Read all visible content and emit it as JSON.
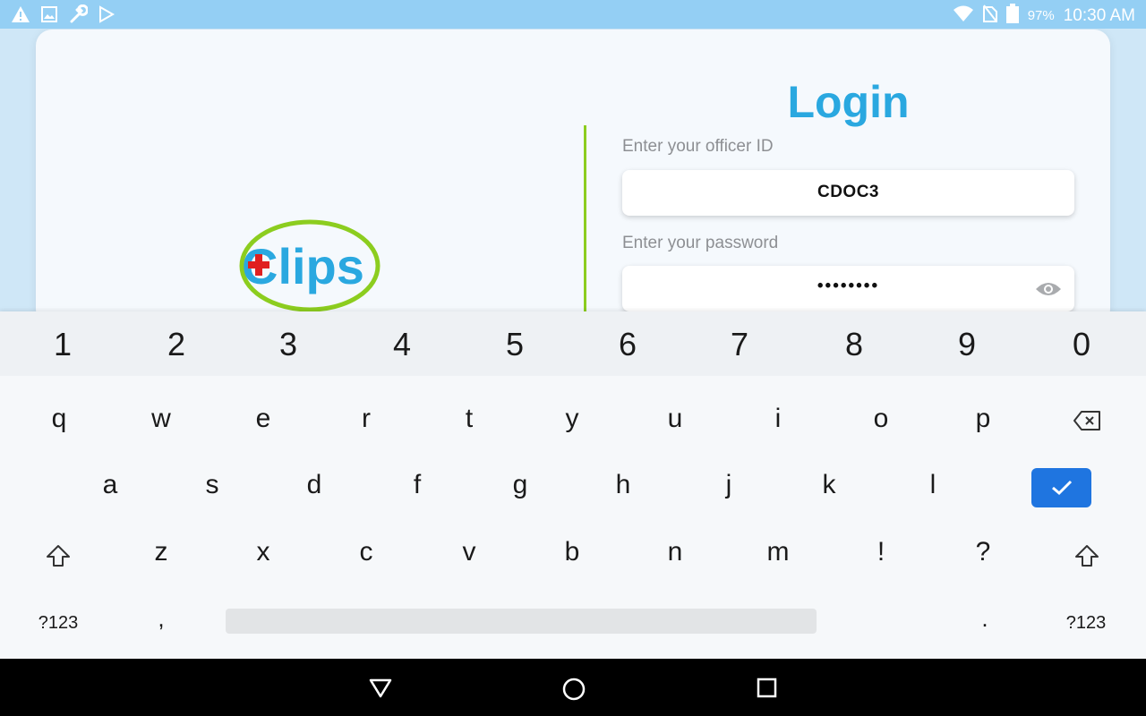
{
  "status_bar": {
    "icons_left": [
      "warning-icon",
      "image-icon",
      "wrench-icon",
      "play-store-icon"
    ],
    "icons_right": [
      "wifi-icon",
      "no-sim-icon",
      "battery-icon"
    ],
    "battery_percent": "97%",
    "time": "10:30 AM"
  },
  "app": {
    "logo_text": "Clips",
    "title": "Login",
    "officer_id_label": "Enter your officer ID",
    "officer_id_value": "CDOC3",
    "password_label": "Enter your password",
    "password_value": "••••••••",
    "colors": {
      "accent": "#2aa8e0",
      "divider": "#8ccd1f",
      "logo_red": "#e02020"
    }
  },
  "keyboard": {
    "numbers": [
      "1",
      "2",
      "3",
      "4",
      "5",
      "6",
      "7",
      "8",
      "9",
      "0"
    ],
    "row1": [
      "q",
      "w",
      "e",
      "r",
      "t",
      "y",
      "u",
      "i",
      "o",
      "p"
    ],
    "row2": [
      "a",
      "s",
      "d",
      "f",
      "g",
      "h",
      "j",
      "k",
      "l"
    ],
    "row3": [
      "z",
      "x",
      "c",
      "v",
      "b",
      "n",
      "m",
      "!",
      "?"
    ],
    "symbols_left": "?123",
    "comma": ",",
    "period": ".",
    "symbols_right": "?123",
    "enter_color": "#1f75e0"
  },
  "nav": {
    "icons": [
      "back-icon",
      "home-icon",
      "recents-icon"
    ]
  }
}
